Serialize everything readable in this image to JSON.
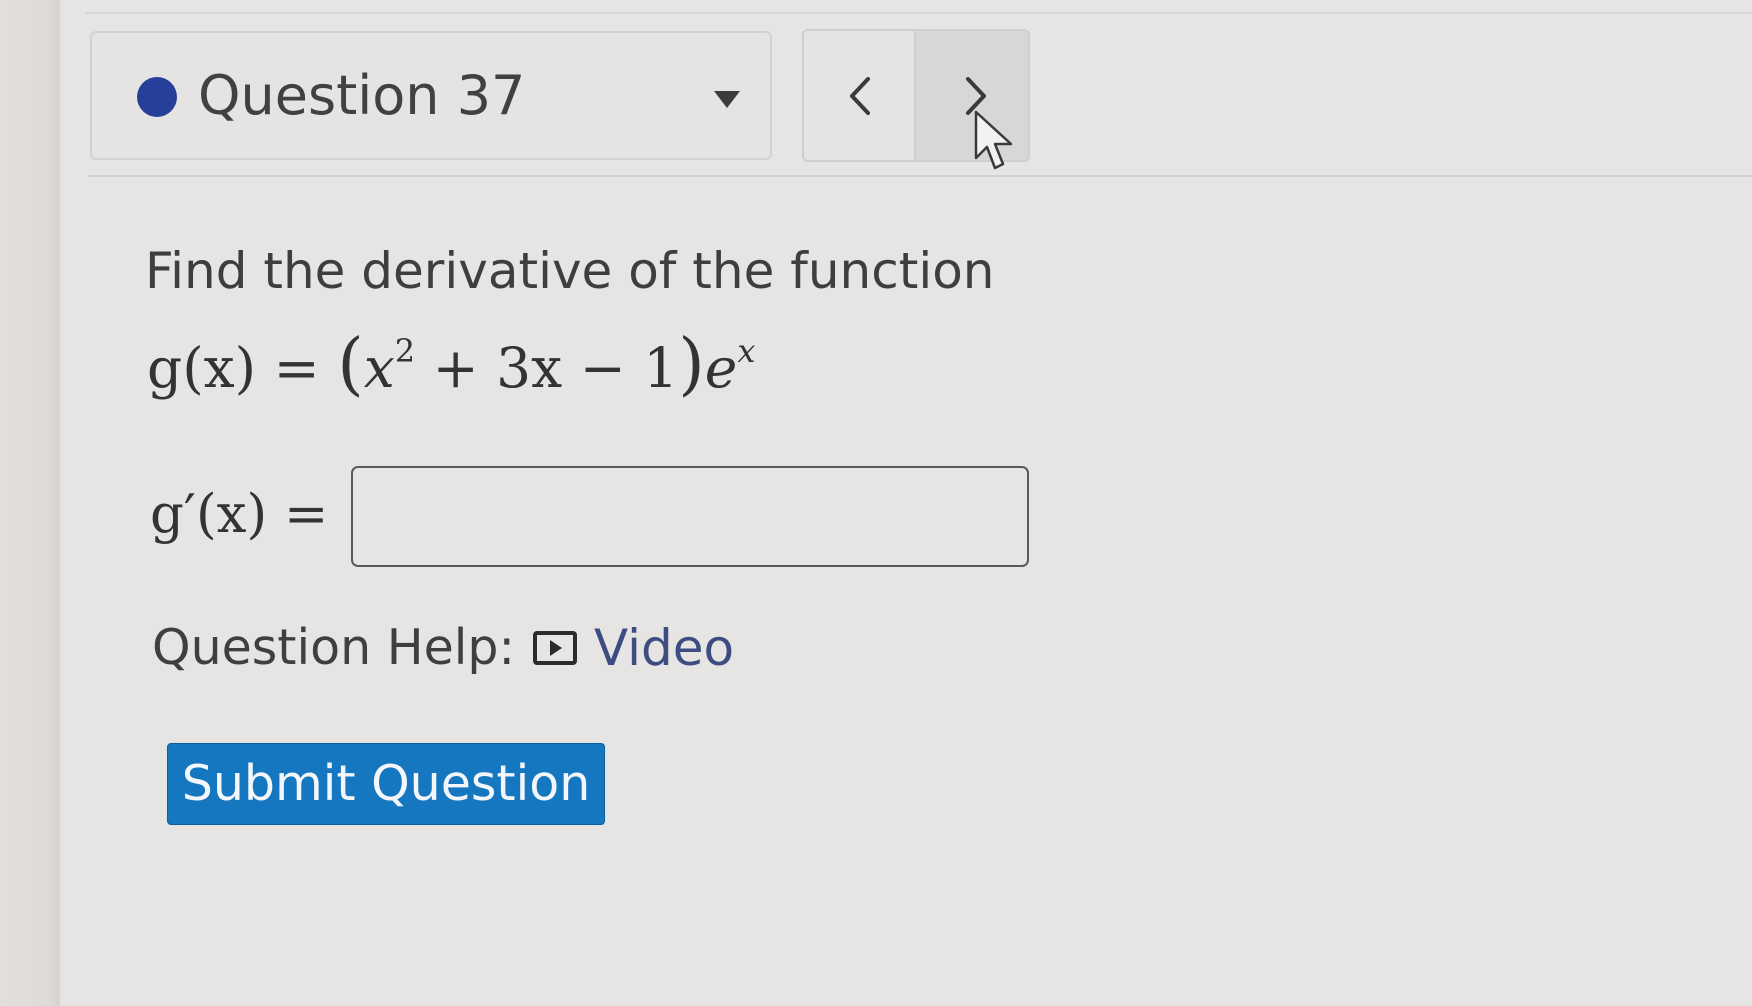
{
  "question_header": {
    "label": "Question 37",
    "status_color": "#263f99",
    "dropdown_icon": "caret-down-icon"
  },
  "navigation": {
    "previous_icon": "chevron-left-icon",
    "next_icon": "chevron-right-icon"
  },
  "question": {
    "prompt": "Find the derivative of the function",
    "formula": {
      "lhs": "g(x) =",
      "base_open": "x",
      "exponent": "2",
      "rest": "+ 3x − 1",
      "factor": "e",
      "factor_exponent": "x"
    },
    "answer_label": "g′(x) =",
    "answer_value": "",
    "answer_placeholder": ""
  },
  "help": {
    "label": "Question Help:",
    "video_label": "Video",
    "video_icon": "video-play-icon"
  },
  "actions": {
    "submit_label": "Submit Question",
    "submit_color": "#1577c0"
  },
  "cursor": {
    "icon": "mouse-pointer-icon"
  }
}
